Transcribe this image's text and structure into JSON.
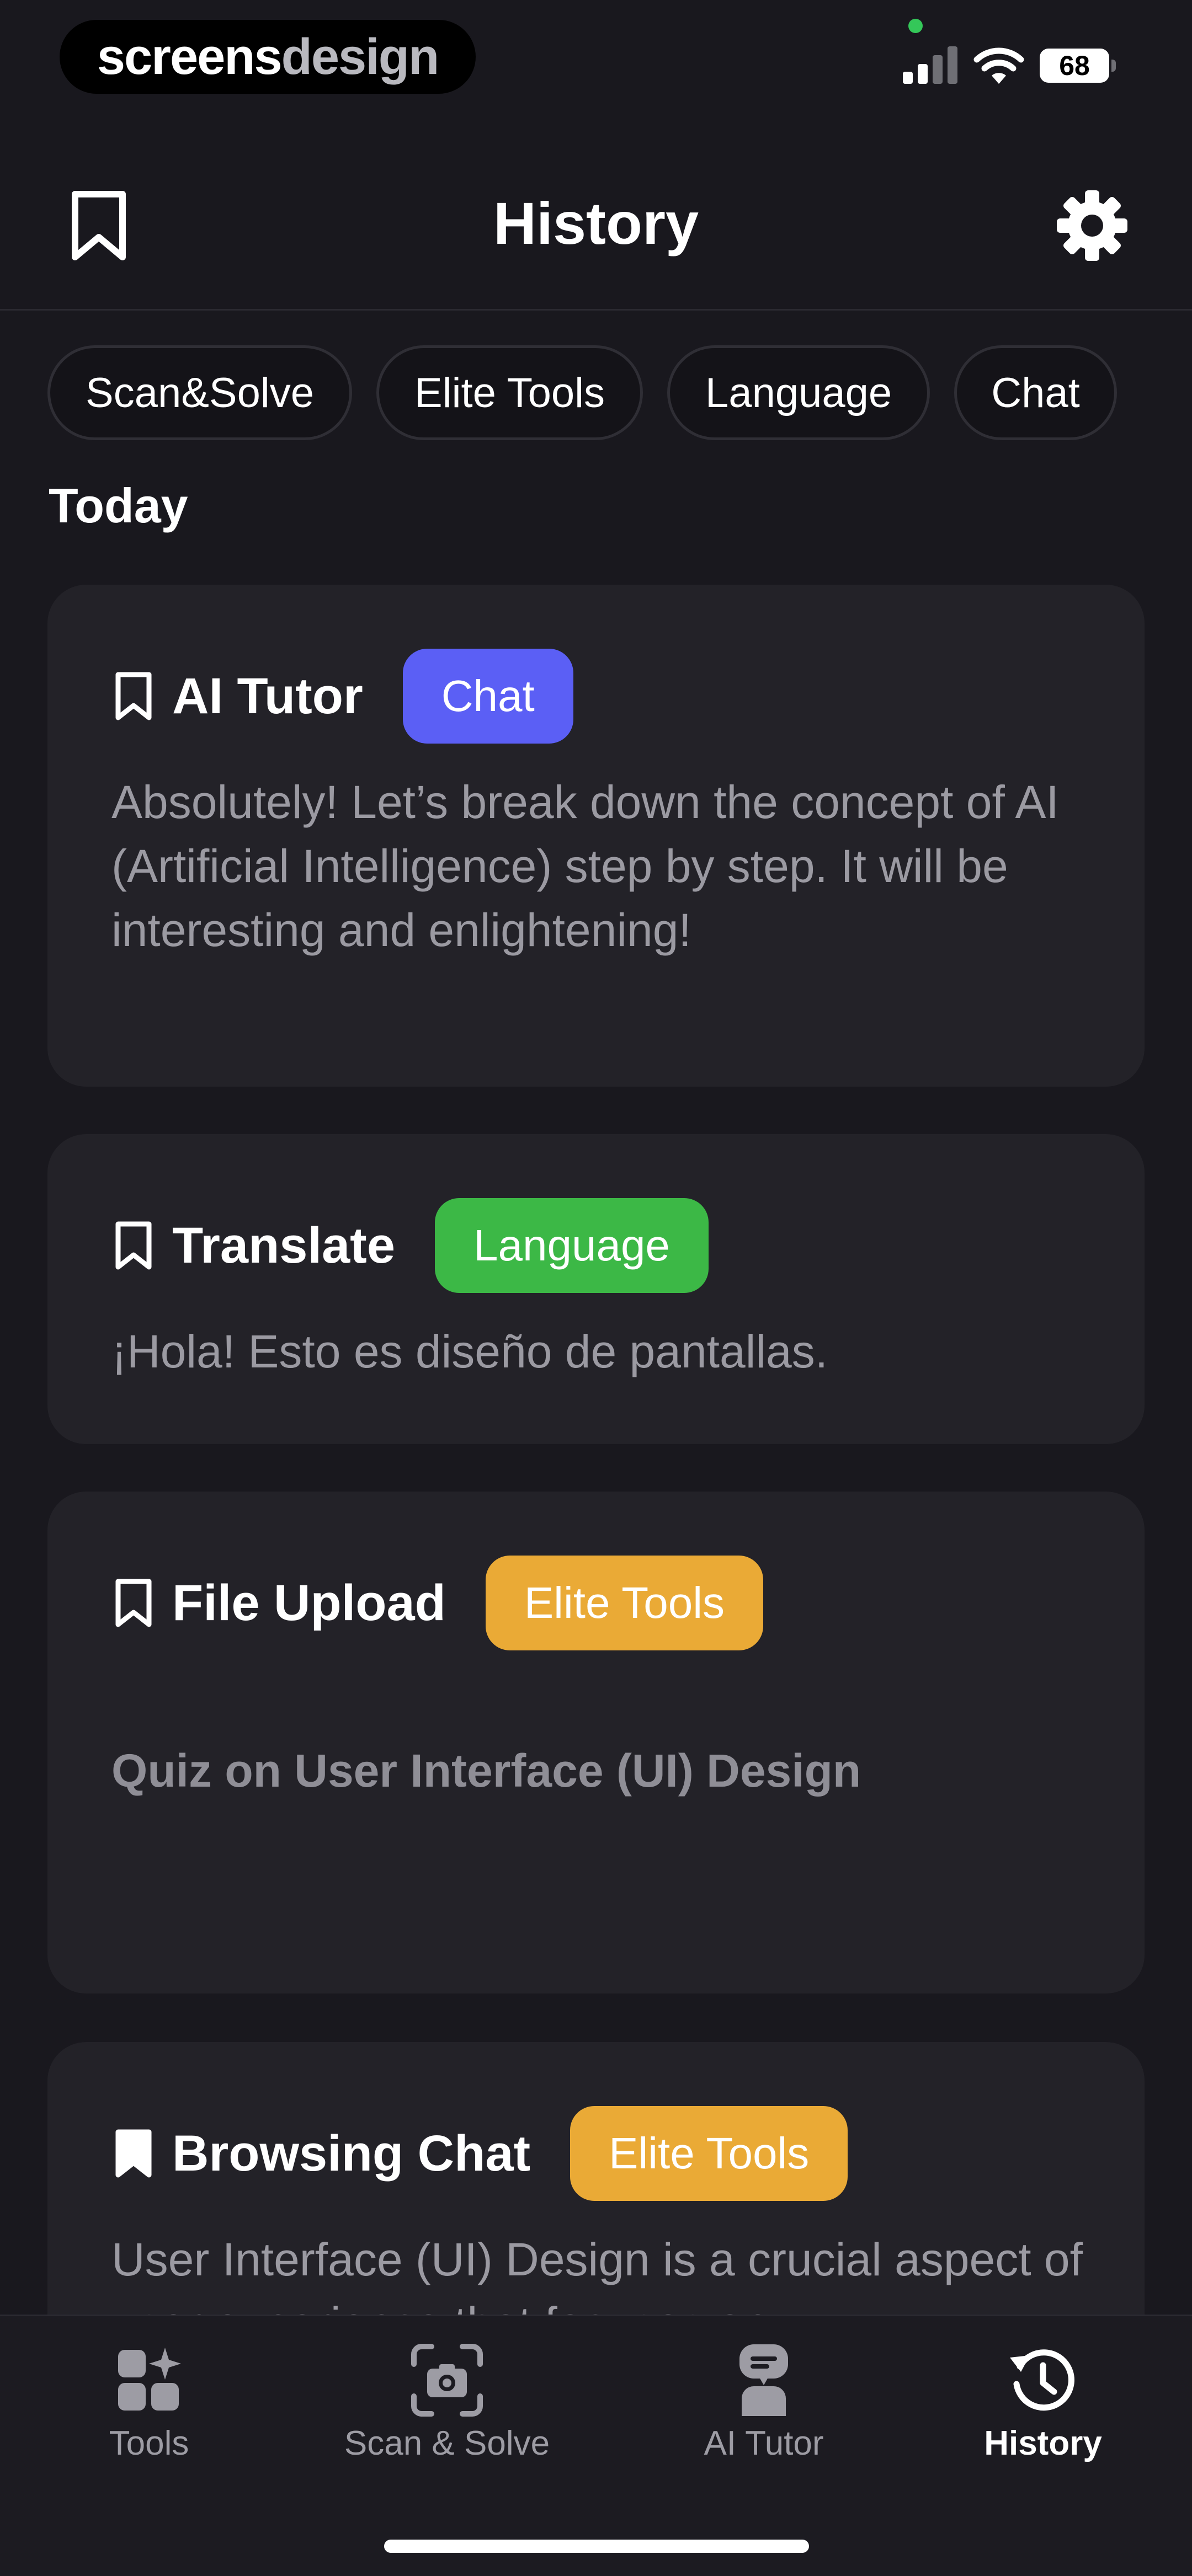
{
  "status_bar": {
    "brand_a": "screens",
    "brand_b": "design",
    "battery": "68"
  },
  "header": {
    "title": "History"
  },
  "filters": [
    "Scan&Solve",
    "Elite Tools",
    "Language",
    "Chat"
  ],
  "section": {
    "title": "Today"
  },
  "cards": [
    {
      "title": "AI Tutor",
      "tag": "Chat",
      "tag_color": "#5b5ff5",
      "text": "Absolutely! Let’s break down the concept of AI (Artificial Intelligence) step by step. It will be interesting and enlightening!"
    },
    {
      "title": "Translate",
      "tag": "Language",
      "tag_color": "#3cb846",
      "text": "¡Hola! Esto es diseño de pantallas."
    },
    {
      "title": "File Upload",
      "tag": "Elite Tools",
      "tag_color": "#eaaa36",
      "text": "Quiz on User Interface (UI) Design"
    },
    {
      "title": "Browsing Chat",
      "tag": "Elite Tools",
      "tag_color": "#eaaa36",
      "text": "User Interface (UI) Design is a crucial aspect of user experience that focuses on"
    }
  ],
  "tabs": [
    {
      "label": "Tools",
      "icon": "tools-grid-icon"
    },
    {
      "label": "Scan & Solve",
      "icon": "camera-scan-icon"
    },
    {
      "label": "AI Tutor",
      "icon": "ai-tutor-icon"
    },
    {
      "label": "History",
      "icon": "history-clock-icon",
      "active": true
    }
  ]
}
